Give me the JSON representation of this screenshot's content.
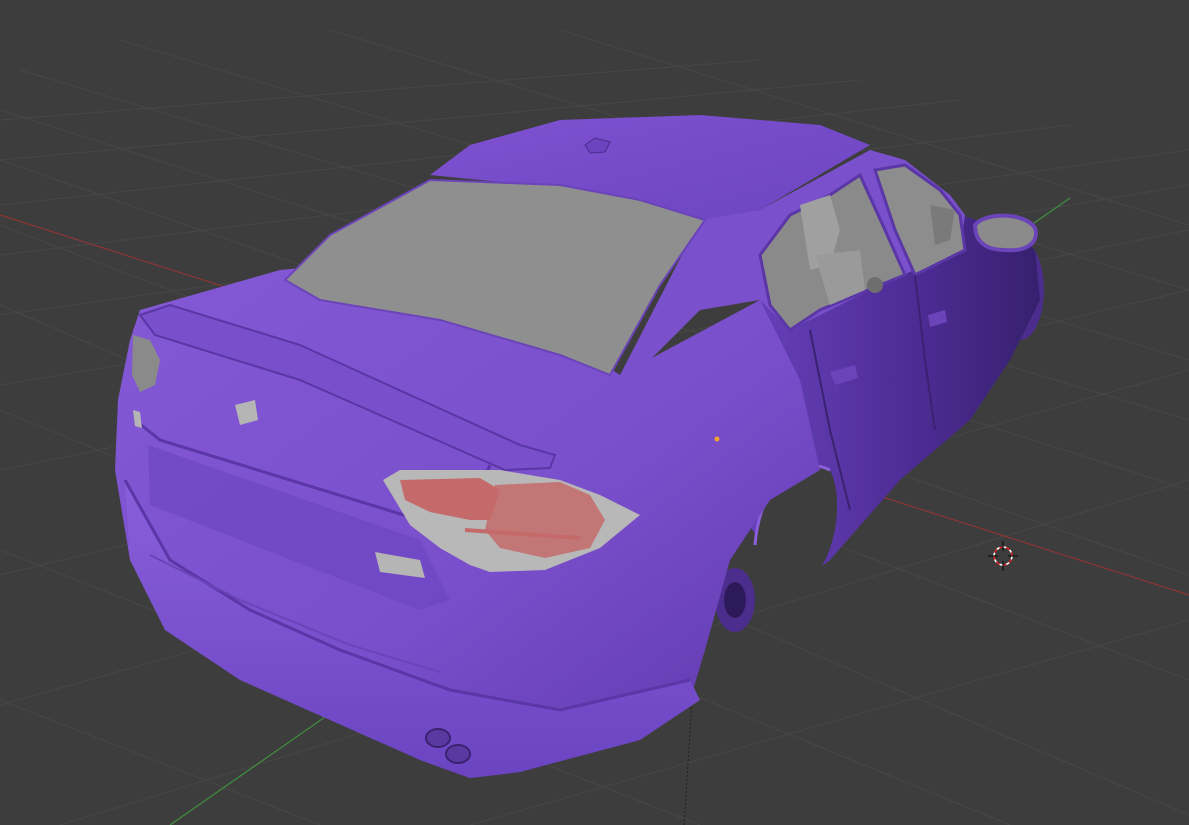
{
  "viewport": {
    "background_color": "#3d3d3d",
    "grid_color": "#4a4a4a",
    "x_axis_color": "#9a3a3a",
    "y_axis_color": "#4e9a4e",
    "z_axis_color": "#1e1e1e"
  },
  "model": {
    "body_color": "#7a4fcc",
    "body_shadow_color": "#4a2a8a",
    "glass_color": "#8f8f8f",
    "taillight_color": "#c46a6a",
    "tire_color": "#5a3aa0"
  },
  "icons": {
    "cursor": "3d-cursor-icon",
    "origin": "object-origin-icon"
  }
}
